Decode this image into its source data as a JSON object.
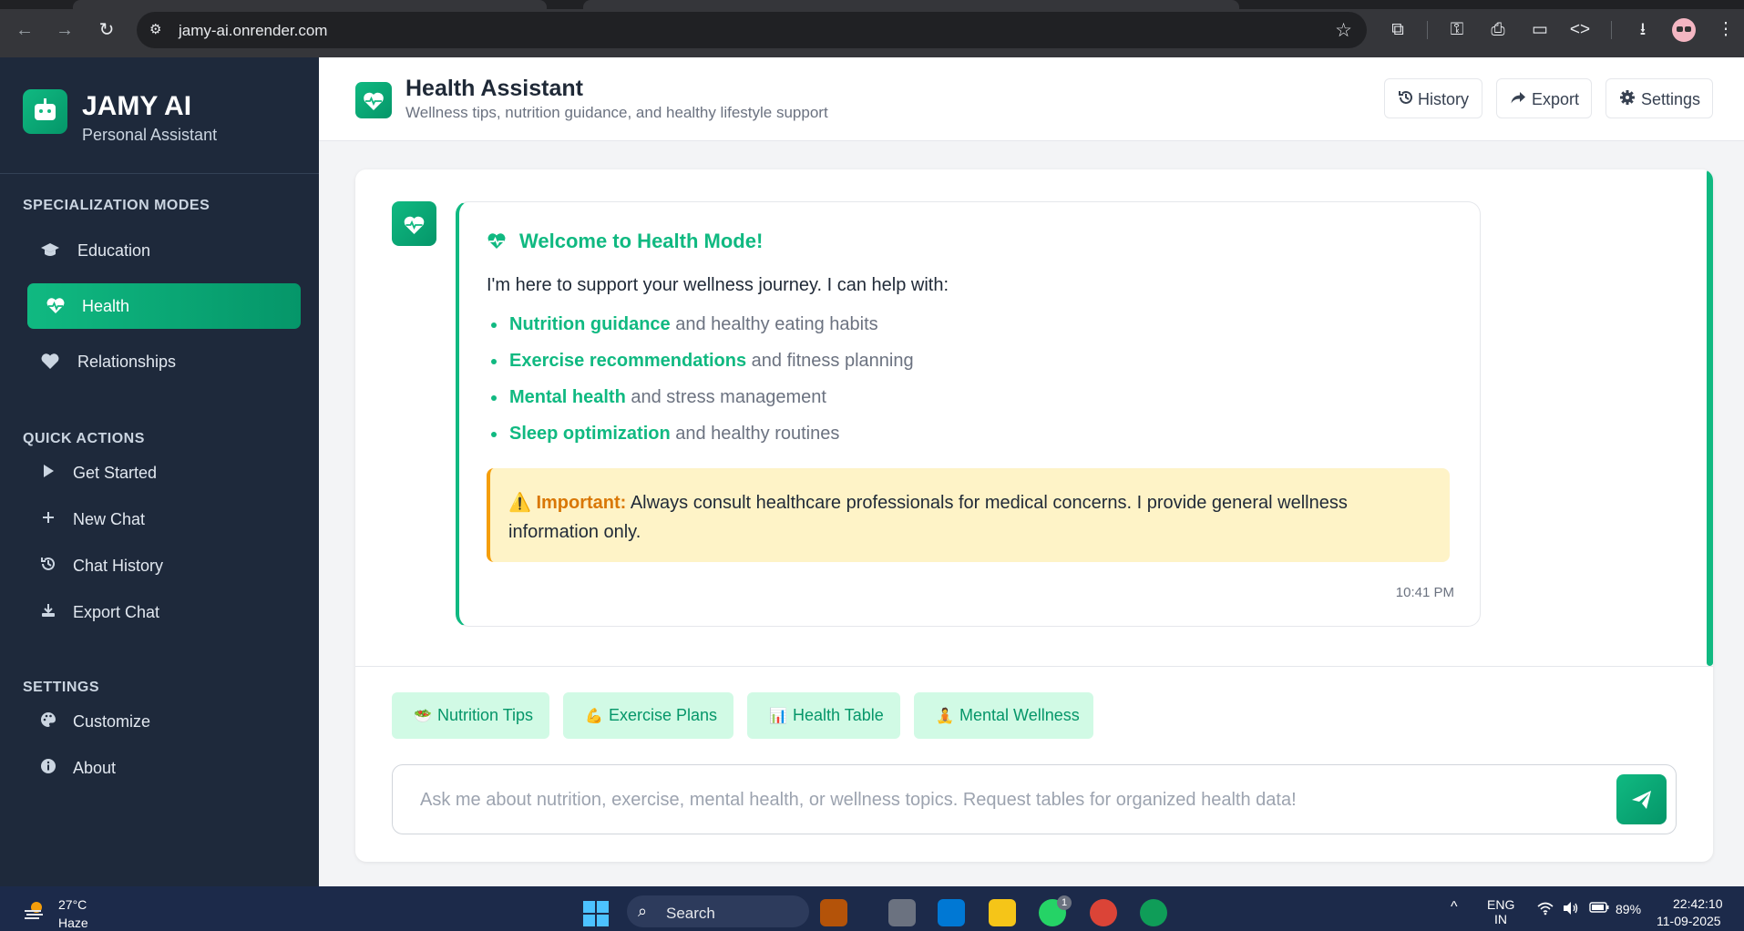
{
  "browser": {
    "url": "jamy-ai.onrender.com"
  },
  "sidebar": {
    "brand_title": "JAMY AI",
    "brand_subtitle": "Personal Assistant",
    "modes_title": "SPECIALIZATION MODES",
    "modes": [
      {
        "label": "Education",
        "icon": "graduation-cap-icon",
        "active": false
      },
      {
        "label": "Health",
        "icon": "heartbeat-icon",
        "active": true
      },
      {
        "label": "Relationships",
        "icon": "heart-icon",
        "active": false
      }
    ],
    "quick_title": "QUICK ACTIONS",
    "quick_actions": [
      {
        "label": "Get Started",
        "icon": "play-icon"
      },
      {
        "label": "New Chat",
        "icon": "plus-icon"
      },
      {
        "label": "Chat History",
        "icon": "history-icon"
      },
      {
        "label": "Export Chat",
        "icon": "download-icon"
      }
    ],
    "settings_title": "SETTINGS",
    "settings": [
      {
        "label": "Customize",
        "icon": "palette-icon"
      },
      {
        "label": "About",
        "icon": "info-icon"
      }
    ]
  },
  "header": {
    "title": "Health Assistant",
    "subtitle": "Wellness tips, nutrition guidance, and healthy lifestyle support",
    "buttons": [
      {
        "label": "History",
        "icon": "history-icon"
      },
      {
        "label": "Export",
        "icon": "share-icon"
      },
      {
        "label": "Settings",
        "icon": "gear-icon"
      }
    ]
  },
  "message": {
    "title": "Welcome to Health Mode!",
    "intro": "I'm here to support your wellness journey. I can help with:",
    "items": [
      {
        "bold": "Nutrition guidance",
        "rest": " and healthy eating habits"
      },
      {
        "bold": "Exercise recommendations",
        "rest": " and fitness planning"
      },
      {
        "bold": "Mental health",
        "rest": " and stress management"
      },
      {
        "bold": "Sleep optimization",
        "rest": " and healthy routines"
      }
    ],
    "important_icon": "⚠️",
    "important_label": "Important:",
    "important_text": " Always consult healthcare professionals for medical concerns. I provide general wellness information only.",
    "time": "10:41 PM"
  },
  "chips": [
    {
      "emoji": "🥗",
      "label": "Nutrition Tips"
    },
    {
      "emoji": "💪",
      "label": "Exercise Plans"
    },
    {
      "emoji": "📊",
      "label": "Health Table"
    },
    {
      "emoji": "🧘",
      "label": "Mental Wellness"
    }
  ],
  "input": {
    "placeholder": "Ask me about nutrition, exercise, mental health, or wellness topics. Request tables for organized health data!"
  },
  "taskbar": {
    "temperature": "27°C",
    "condition": "Haze",
    "search_label": "Search",
    "badge": "1",
    "language_top": "ENG",
    "language_bottom": "IN",
    "battery": "89%",
    "time": "22:42:10",
    "date": "11-09-2025"
  },
  "colors": {
    "accent": "#10b981",
    "sidebar_bg": "#1e293b",
    "warning": "#f59e0b"
  }
}
